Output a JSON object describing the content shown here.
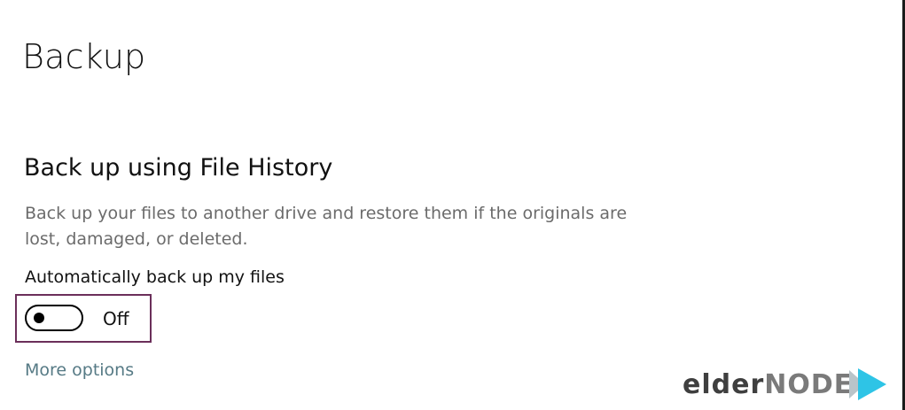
{
  "page": {
    "title": "Backup"
  },
  "file_history": {
    "heading": "Back up using File History",
    "description": "Back up your files to another drive and restore them if the originals are lost, damaged, or deleted.",
    "auto_backup_label": "Automatically back up my files",
    "toggle_state": "Off",
    "more_options_link": "More options"
  },
  "watermark": {
    "text_part1": "elder",
    "text_part2": "node"
  },
  "colors": {
    "highlight_border": "#6b2f5a",
    "link": "#567a85",
    "description_text": "#6b6b6b",
    "watermark_arrow": "#2ec4e6"
  },
  "icons": {
    "watermark_logo": "play-arrow-icon"
  }
}
